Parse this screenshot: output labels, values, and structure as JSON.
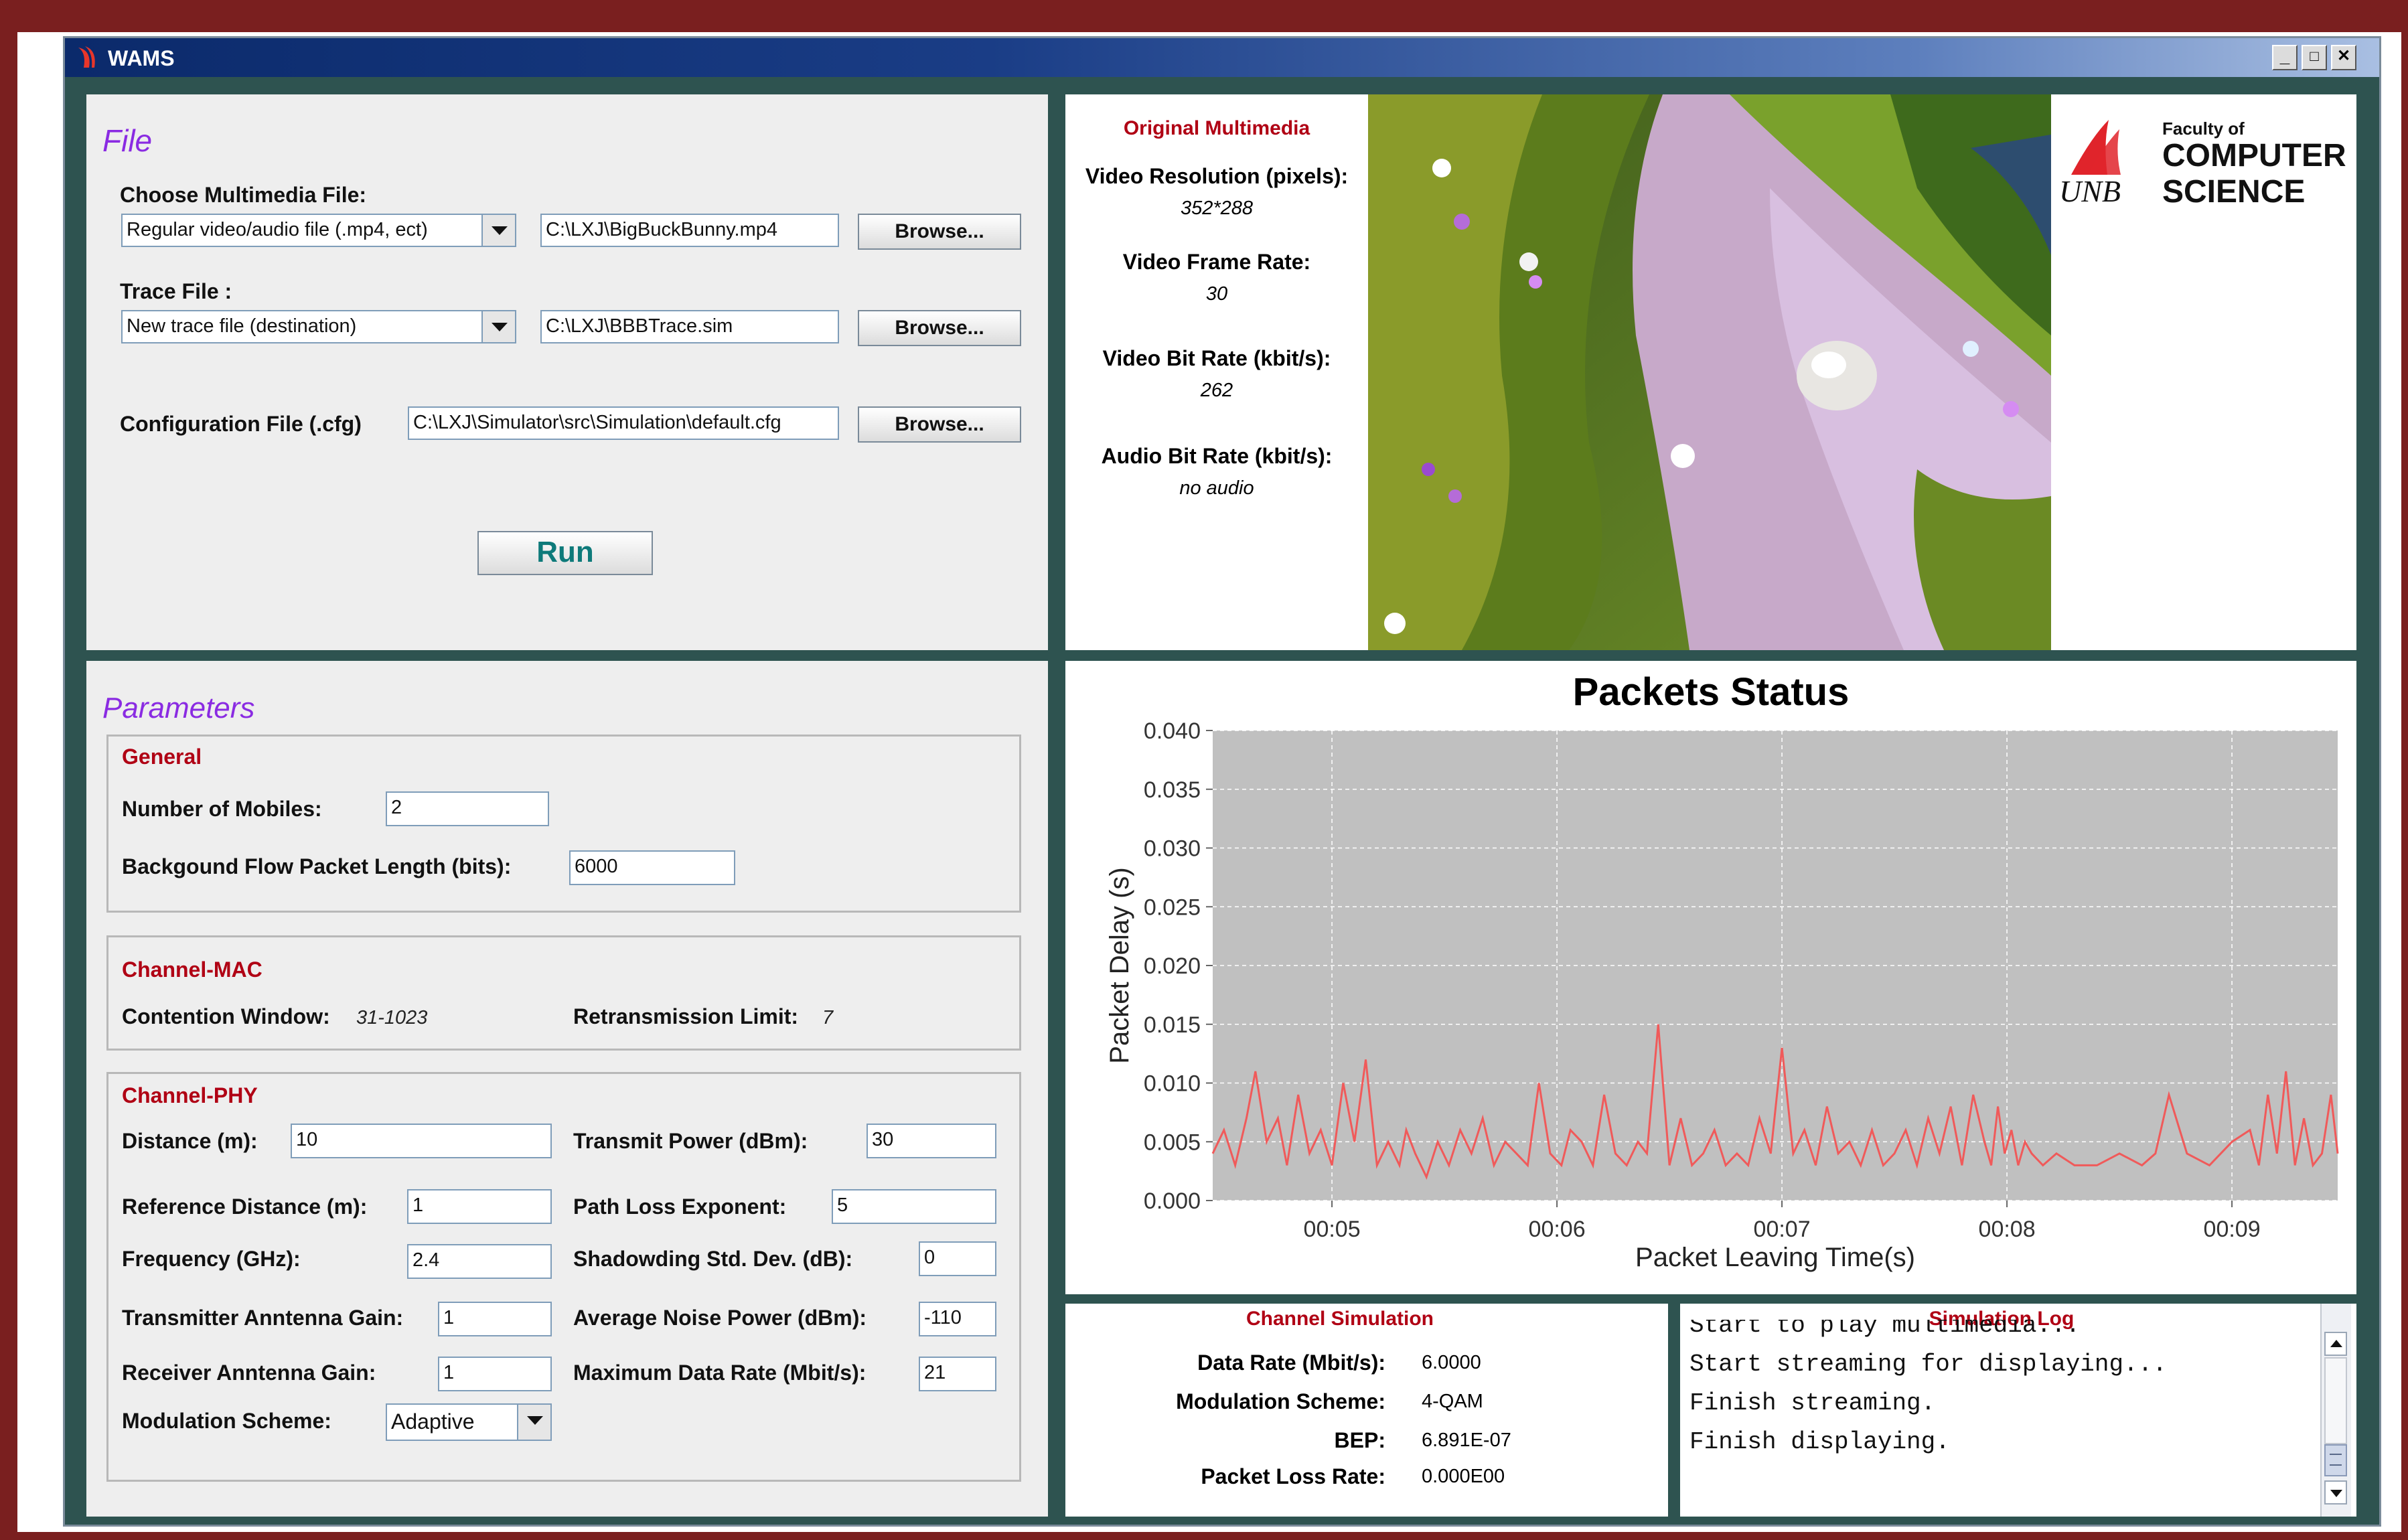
{
  "window": {
    "title": "WAMS",
    "controls": [
      "_",
      "□",
      "✕"
    ]
  },
  "file_panel": {
    "heading": "File",
    "multimedia_label": "Choose Multimedia File:",
    "multimedia_type": "Regular video/audio file (.mp4, ect)",
    "multimedia_path": "C:\\LXJ\\BigBuckBunny.mp4",
    "trace_label": "Trace File :",
    "trace_type": "New trace file (destination)",
    "trace_path": "C:\\LXJ\\BBBTrace.sim",
    "config_label": "Configuration File (.cfg)",
    "config_path": "C:\\LXJ\\Simulator\\src\\Simulation\\default.cfg",
    "browse_label": "Browse...",
    "run_label": "Run"
  },
  "media_info": {
    "heading": "Original Multimedia",
    "resolution_label": "Video Resolution (pixels):",
    "resolution_value": "352*288",
    "frame_rate_label": "Video Frame Rate:",
    "frame_rate_value": "30",
    "video_bitrate_label": "Video Bit Rate (kbit/s):",
    "video_bitrate_value": "262",
    "audio_bitrate_label": "Audio Bit Rate (kbit/s):",
    "audio_bitrate_value": "no audio"
  },
  "logo": {
    "line1": "Faculty of",
    "line2": "COMPUTER",
    "line3": "SCIENCE",
    "mark": "UNB"
  },
  "parameters": {
    "heading": "Parameters",
    "general": {
      "title": "General",
      "mobiles_label": "Number of Mobiles:",
      "mobiles_value": "2",
      "packet_len_label": "Backgound Flow Packet Length (bits):",
      "packet_len_value": "6000"
    },
    "mac": {
      "title": "Channel-MAC",
      "cw_label": "Contention Window:",
      "cw_value": "31-1023",
      "retx_label": "Retransmission Limit:",
      "retx_value": "7"
    },
    "phy": {
      "title": "Channel-PHY",
      "distance_label": "Distance (m):",
      "distance_value": "10",
      "tx_power_label": "Transmit Power (dBm):",
      "tx_power_value": "30",
      "ref_dist_label": "Reference Distance (m):",
      "ref_dist_value": "1",
      "path_loss_label": "Path Loss Exponent:",
      "path_loss_value": "5",
      "freq_label": "Frequency (GHz):",
      "freq_value": "2.4",
      "shadow_label": "Shadowding Std. Dev. (dB):",
      "shadow_value": "0",
      "tx_gain_label": "Transmitter Anntenna Gain:",
      "tx_gain_value": "1",
      "noise_label": "Average Noise Power (dBm):",
      "noise_value": "-110",
      "rx_gain_label": "Receiver Anntenna Gain:",
      "rx_gain_value": "1",
      "max_rate_label": "Maximum Data Rate (Mbit/s):",
      "max_rate_value": "21",
      "modulation_label": "Modulation Scheme:",
      "modulation_value": "Adaptive"
    }
  },
  "channel_sim": {
    "heading": "Channel Simulation",
    "data_rate_label": "Data Rate (Mbit/s):",
    "data_rate_value": "6.0000",
    "mod_label": "Modulation Scheme:",
    "mod_value": "4-QAM",
    "bep_label": "BEP:",
    "bep_value": "6.891E-07",
    "loss_label": "Packet Loss Rate:",
    "loss_value": "0.000E00"
  },
  "sim_log": {
    "heading": "Simulation Log",
    "lines": [
      "Start to play multimedia...",
      "Start streaming for displaying...",
      "Finish streaming.",
      "Finish displaying."
    ]
  },
  "colors": {
    "accent_red": "#b00014",
    "heading_purple": "#8a2be2",
    "series": "#f05a5a",
    "plot_bg": "#c0c0c0"
  },
  "chart_data": {
    "type": "line",
    "title": "Packets Status",
    "xlabel": "Packet Leaving Time(s)",
    "ylabel": "Packet Delay (s)",
    "x_tick_labels": [
      "00:05",
      "00:06",
      "00:07",
      "00:08",
      "00:09"
    ],
    "x_ticks": [
      5,
      6,
      7,
      8,
      9
    ],
    "y_ticks": [
      "0.000",
      "0.005",
      "0.010",
      "0.015",
      "0.020",
      "0.025",
      "0.030",
      "0.035",
      "0.040"
    ],
    "xlim": [
      4.47,
      9.47
    ],
    "ylim": [
      0,
      0.04
    ],
    "grid": true,
    "series": [
      {
        "color": "#f05a5a",
        "x": [
          4.47,
          4.52,
          4.57,
          4.62,
          4.66,
          4.71,
          4.76,
          4.8,
          4.85,
          4.9,
          4.95,
          5.0,
          5.05,
          5.1,
          5.15,
          5.2,
          5.25,
          5.3,
          5.33,
          5.37,
          5.42,
          5.47,
          5.52,
          5.57,
          5.62,
          5.67,
          5.72,
          5.77,
          5.82,
          5.87,
          5.92,
          5.97,
          6.02,
          6.06,
          6.11,
          6.16,
          6.21,
          6.26,
          6.31,
          6.36,
          6.4,
          6.45,
          6.5,
          6.55,
          6.6,
          6.65,
          6.7,
          6.75,
          6.8,
          6.85,
          6.9,
          6.95,
          7.0,
          7.05,
          7.1,
          7.15,
          7.2,
          7.25,
          7.3,
          7.35,
          7.4,
          7.45,
          7.5,
          7.55,
          7.6,
          7.65,
          7.7,
          7.75,
          7.8,
          7.85,
          7.9,
          7.93,
          7.96,
          7.99,
          8.02,
          8.05,
          8.08,
          8.11,
          8.16,
          8.22,
          8.3,
          8.4,
          8.5,
          8.6,
          8.66,
          8.72,
          8.8,
          8.9,
          9.0,
          9.08,
          9.12,
          9.16,
          9.2,
          9.24,
          9.28,
          9.32,
          9.36,
          9.4,
          9.44,
          9.47
        ],
        "y": [
          0.004,
          0.006,
          0.003,
          0.007,
          0.011,
          0.005,
          0.007,
          0.003,
          0.009,
          0.004,
          0.006,
          0.003,
          0.01,
          0.005,
          0.012,
          0.003,
          0.005,
          0.003,
          0.006,
          0.004,
          0.002,
          0.005,
          0.003,
          0.006,
          0.004,
          0.007,
          0.003,
          0.005,
          0.004,
          0.003,
          0.01,
          0.004,
          0.003,
          0.006,
          0.005,
          0.003,
          0.009,
          0.004,
          0.003,
          0.005,
          0.004,
          0.015,
          0.003,
          0.007,
          0.003,
          0.004,
          0.006,
          0.003,
          0.004,
          0.003,
          0.007,
          0.004,
          0.013,
          0.004,
          0.006,
          0.003,
          0.008,
          0.004,
          0.005,
          0.003,
          0.006,
          0.003,
          0.004,
          0.006,
          0.003,
          0.007,
          0.004,
          0.008,
          0.003,
          0.009,
          0.005,
          0.003,
          0.008,
          0.004,
          0.006,
          0.003,
          0.005,
          0.004,
          0.003,
          0.004,
          0.003,
          0.003,
          0.004,
          0.003,
          0.004,
          0.009,
          0.004,
          0.003,
          0.005,
          0.006,
          0.003,
          0.009,
          0.004,
          0.011,
          0.003,
          0.007,
          0.003,
          0.004,
          0.009,
          0.004
        ]
      }
    ]
  }
}
